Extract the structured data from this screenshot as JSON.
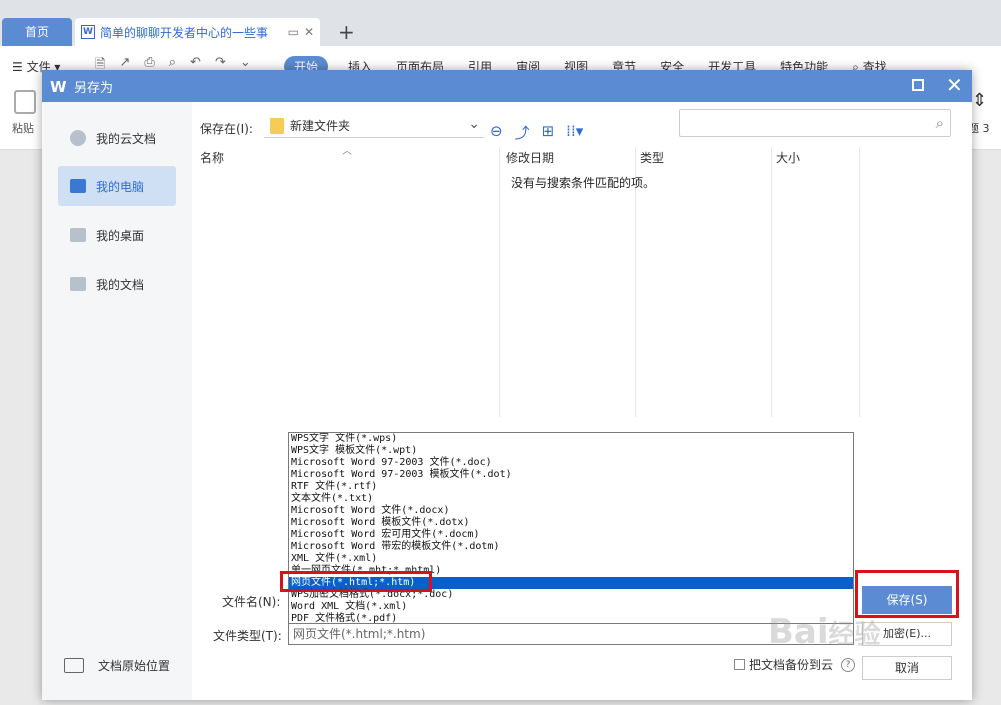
{
  "app": {
    "tabs": [
      {
        "label": "首页"
      },
      {
        "label": "简单的聊聊开发者中心的一些事"
      }
    ],
    "menu_file": "文件",
    "menu_items": [
      "开始",
      "插入",
      "页面布局",
      "引用",
      "审阅",
      "视图",
      "章节",
      "安全",
      "开发工具",
      "特色功能",
      "查找"
    ],
    "active_menu": "开始",
    "paste_label": "粘贴",
    "right_label": "题 3"
  },
  "dialog": {
    "title": "另存为",
    "sidebar": [
      {
        "label": "我的云文档",
        "icon": "cloud-icon",
        "active": false
      },
      {
        "label": "我的电脑",
        "icon": "computer-icon",
        "active": true
      },
      {
        "label": "我的桌面",
        "icon": "desktop-icon",
        "active": false
      },
      {
        "label": "我的文档",
        "icon": "folder-icon",
        "active": false
      }
    ],
    "sidebar_bottom": "文档原始位置",
    "save_in_label": "保存在(I):",
    "save_in_value": "新建文件夹",
    "search_placeholder": "",
    "columns": [
      "名称",
      "修改日期",
      "类型",
      "大小"
    ],
    "empty_message": "没有与搜索条件匹配的项。",
    "filename_label": "文件名(N):",
    "filetype_label": "文件类型(T):",
    "filetype_value": "网页文件(*.html;*.htm)",
    "save_button": "保存(S)",
    "secondary_button": "加密(E)...",
    "cancel_button": "取消",
    "backup_label": "把文档备份到云",
    "dropdown_options": [
      "WPS文字 文件(*.wps)",
      "WPS文字 模板文件(*.wpt)",
      "Microsoft Word 97-2003 文件(*.doc)",
      "Microsoft Word 97-2003 模板文件(*.dot)",
      "RTF 文件(*.rtf)",
      "文本文件(*.txt)",
      "Microsoft Word 文件(*.docx)",
      "Microsoft Word 模板文件(*.dotx)",
      "Microsoft Word 宏可用文件(*.docm)",
      "Microsoft Word 带宏的模板文件(*.dotm)",
      "XML 文件(*.xml)",
      "单一网页文件(*.mht;*.mhtml)",
      "网页文件(*.html;*.htm)",
      "WPS加密文档格式(*.docx;*.doc)",
      "Word XML 文档(*.xml)",
      "PDF 文件格式(*.pdf)"
    ],
    "selected_option_index": 12
  },
  "watermark": "Baidu经验",
  "colors": {
    "accent": "#5b8bd3",
    "highlight": "#d9121a",
    "selection": "#0a60c8"
  }
}
